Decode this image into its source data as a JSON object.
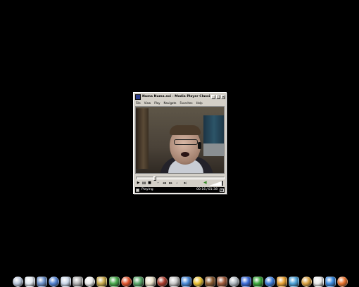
{
  "window": {
    "title": "Numa Numa.avi - Media Player Classic",
    "close_label": "×",
    "minimize_label": "_",
    "maximize_label": "□"
  },
  "menu": [
    "File",
    "View",
    "Play",
    "Navigate",
    "Favorites",
    "Help"
  ],
  "playback": {
    "seek_fraction": 0.2
  },
  "controls": {
    "play": "▶",
    "pause": "❚❚",
    "stop": "■",
    "prev": "⏮",
    "rewind": "◀◀",
    "forward": "▶▶",
    "next": "⏭",
    "frame_step": "▶|",
    "volume_fraction": 1.0
  },
  "status": {
    "state": "Playing",
    "position": "00:16",
    "separator": "/",
    "duration": "01:38"
  },
  "dock": {
    "icons": [
      {
        "name": "clock-icon",
        "color": "#b8c4d8"
      },
      {
        "name": "cloud-icon",
        "color": "#dfe6ee"
      },
      {
        "name": "monitor-icon",
        "color": "#6a8fc8"
      },
      {
        "name": "notebook-icon",
        "color": "#4f7fd0"
      },
      {
        "name": "disc-icon",
        "color": "#c9d6e8"
      },
      {
        "name": "pen-icon",
        "color": "#b0b0b0"
      },
      {
        "name": "document-icon",
        "color": "#e8e8e8"
      },
      {
        "name": "wrench-icon",
        "color": "#c8a84a"
      },
      {
        "name": "orb-icon",
        "color": "#46a84a"
      },
      {
        "name": "flame-icon",
        "color": "#e0532c"
      },
      {
        "name": "feather-icon",
        "color": "#5aa86a"
      },
      {
        "name": "paper-icon",
        "color": "#e8e0c8"
      },
      {
        "name": "clapper-icon",
        "color": "#a83a2a"
      },
      {
        "name": "magnifier-icon",
        "color": "#c8c8c8"
      },
      {
        "name": "globe-icon",
        "color": "#4a8ad8"
      },
      {
        "name": "star-icon",
        "color": "#e8c030"
      },
      {
        "name": "chest-icon",
        "color": "#8a5a30"
      },
      {
        "name": "bag-icon",
        "color": "#a05a3a"
      },
      {
        "name": "shield-icon",
        "color": "#b0b8c0"
      },
      {
        "name": "magnet-icon",
        "color": "#3a6ad8"
      },
      {
        "name": "recycle-icon",
        "color": "#3aa83a"
      },
      {
        "name": "media-play-icon",
        "color": "#3a7ad8"
      },
      {
        "name": "fish-icon",
        "color": "#e8a030"
      },
      {
        "name": "people-icon",
        "color": "#4aa0d8"
      },
      {
        "name": "person-icon",
        "color": "#d8a040"
      },
      {
        "name": "chat-icon",
        "color": "#eaeaea"
      },
      {
        "name": "earth-icon",
        "color": "#3a8ae0"
      },
      {
        "name": "firefox-icon",
        "color": "#e8702a"
      }
    ]
  }
}
